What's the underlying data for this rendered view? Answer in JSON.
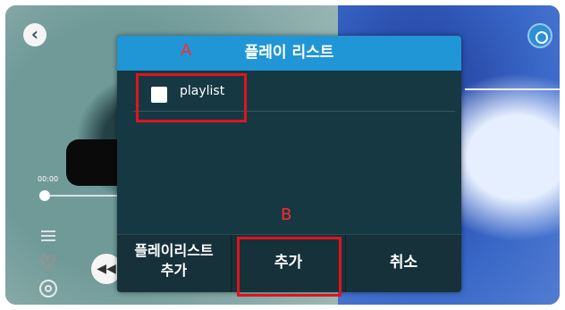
{
  "dialog": {
    "title": "플레이 리스트",
    "playlist_item": "playlist",
    "playlist_checked": false,
    "buttons": {
      "add_playlist_line1": "플레이리스트",
      "add_playlist_line2": "추가",
      "add": "추가",
      "cancel": "취소"
    }
  },
  "player": {
    "time": "00:00",
    "behind_text": "...  :  |¹|"
  },
  "annotations": {
    "label_a": "A",
    "label_b": "B"
  },
  "icons": {
    "back": "back-icon",
    "settings": "settings-icon",
    "menu": "menu-icon",
    "heart": "heart-icon",
    "target": "target-icon",
    "prev": "previous-icon"
  },
  "colors": {
    "dialog_header": "#2196d6",
    "dialog_body": "#163843",
    "annotation_red": "#e0141b"
  }
}
